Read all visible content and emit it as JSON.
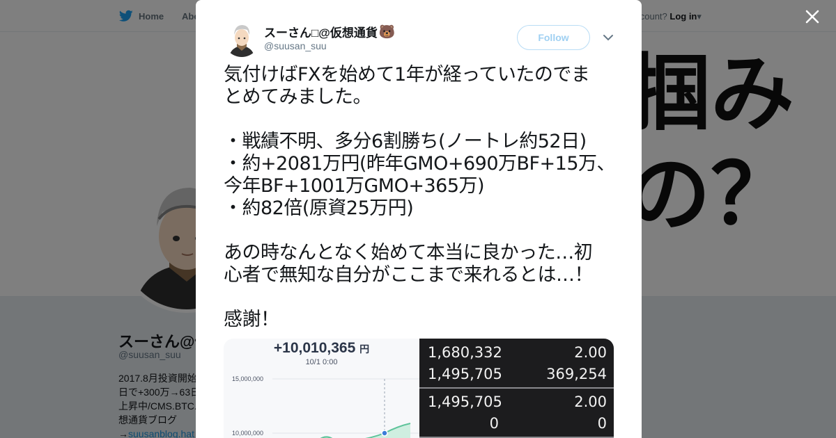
{
  "background": {
    "nav": {
      "home_label": "Home",
      "about_label": "Abo",
      "login_prompt": "account?",
      "login_label": "Log in"
    },
    "banner_text": [
      "掴み",
      "の？"
    ],
    "profile": {
      "name": "スーさん@仮",
      "handle": "@suusan_suu",
      "bio_lines": [
        "2017.8月投資開始",
        "日で+300万→63日",
        "上昇中/CMS.BTC.",
        "想通貨ブログ"
      ],
      "bio_link": "suusanblog.hat"
    }
  },
  "tweet": {
    "display_name": "スーさん□@仮想通貨",
    "display_emoji": "🐻",
    "handle": "@suusan_suu",
    "follow_label": "Follow",
    "text_lines": [
      "気付けばFXを始めて1年が経っていたのでま",
      "とめてみました。",
      "",
      "・戦績不明、多分6割勝ち(ノートレ約52日)",
      "・約+2081万円(昨年GMO+690万BF+15万、",
      "今年BF+1001万GMO+365万)",
      "・約82倍(原資25万円)",
      "",
      "あの時なんとなく始めて本当に良かった…初",
      "心者で無知な自分がここまで来れるとは…！",
      "",
      "感謝！"
    ]
  },
  "media": {
    "left_image": {
      "amount": "+10,010,365",
      "currency": "円",
      "datetime": "10/1 0:00",
      "y_ticks": [
        "15,000,000",
        "10,000,000"
      ]
    },
    "right_image": {
      "rows": [
        {
          "left": "1,680,332",
          "right": "2.00"
        },
        {
          "left": "1,495,705",
          "right": "369,254"
        },
        {
          "left": "1,495,705",
          "right": "2.00"
        },
        {
          "left": "0",
          "right": "0"
        }
      ]
    }
  },
  "colors": {
    "twitter_blue": "#1da1f2",
    "link_blue": "#1b95e0",
    "follow_border": "#b8dcf5",
    "chart_green": "#5ec39a",
    "chart_point": "#3b7dd8"
  }
}
